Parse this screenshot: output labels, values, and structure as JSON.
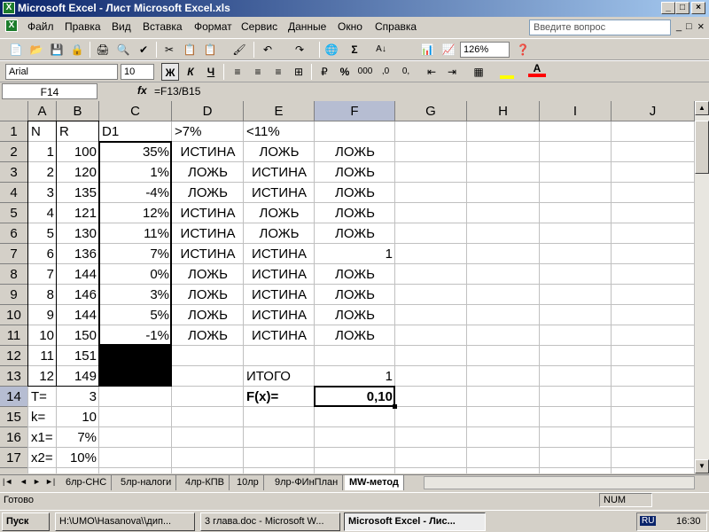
{
  "window": {
    "title": "Microsoft Excel - Лист Microsoft Excel.xls",
    "min": "_",
    "max": "□",
    "close": "×"
  },
  "menu": {
    "items": [
      "Файл",
      "Правка",
      "Вид",
      "Вставка",
      "Формат",
      "Сервис",
      "Данные",
      "Окно",
      "Справка"
    ],
    "help_placeholder": "Введите вопрос",
    "doc_min": "_",
    "doc_max": "□",
    "doc_close": "×"
  },
  "toolbar": {
    "zoom": "126%",
    "buttons": [
      "📄",
      "📂",
      "💾",
      "🔒",
      "🖨",
      "🔍",
      "✔",
      "✂",
      "📋",
      "📋",
      "🖌",
      "↶",
      "↷",
      "🌐",
      "Σ",
      "А↓",
      "📊",
      "📈",
      "❓"
    ]
  },
  "format_bar": {
    "font": "Arial",
    "size": "10",
    "bold": "Ж",
    "italic": "К",
    "underline": "Ч",
    "percent": "%",
    "thousands": "000",
    "other_buttons": [
      "≡",
      "≡",
      "≡",
      "⊞",
      "₽",
      ",0",
      "0,",
      "⇤",
      "⇥",
      "▦",
      "A"
    ]
  },
  "formula_bar": {
    "name_box": "F14",
    "fx": "fx",
    "formula": "=F13/B15"
  },
  "columns": [
    "A",
    "B",
    "C",
    "D",
    "E",
    "F",
    "G",
    "H",
    "I",
    "J"
  ],
  "rows": [
    "1",
    "2",
    "3",
    "4",
    "5",
    "6",
    "7",
    "8",
    "9",
    "10",
    "11",
    "12",
    "13",
    "14",
    "15",
    "16",
    "17",
    "18"
  ],
  "cells": {
    "r1": [
      "N",
      "R",
      "D1",
      ">7%",
      "<11%",
      ""
    ],
    "data": [
      [
        "1",
        "100",
        "35%",
        "ИСТИНА",
        "ЛОЖЬ",
        "ЛОЖЬ"
      ],
      [
        "2",
        "120",
        "1%",
        "ЛОЖЬ",
        "ИСТИНА",
        "ЛОЖЬ"
      ],
      [
        "3",
        "135",
        "-4%",
        "ЛОЖЬ",
        "ИСТИНА",
        "ЛОЖЬ"
      ],
      [
        "4",
        "121",
        "12%",
        "ИСТИНА",
        "ЛОЖЬ",
        "ЛОЖЬ"
      ],
      [
        "5",
        "130",
        "11%",
        "ИСТИНА",
        "ЛОЖЬ",
        "ЛОЖЬ"
      ],
      [
        "6",
        "136",
        "7%",
        "ИСТИНА",
        "ИСТИНА",
        "1"
      ],
      [
        "7",
        "144",
        "0%",
        "ЛОЖЬ",
        "ИСТИНА",
        "ЛОЖЬ"
      ],
      [
        "8",
        "146",
        "3%",
        "ЛОЖЬ",
        "ИСТИНА",
        "ЛОЖЬ"
      ],
      [
        "9",
        "144",
        "5%",
        "ЛОЖЬ",
        "ИСТИНА",
        "ЛОЖЬ"
      ],
      [
        "10",
        "150",
        "-1%",
        "ЛОЖЬ",
        "ИСТИНА",
        "ЛОЖЬ"
      ]
    ],
    "r12": [
      "11",
      "151"
    ],
    "r13": [
      "12",
      "149",
      "ИТОГО",
      "1"
    ],
    "r14": [
      "T=",
      "3",
      "F(x)=",
      "0,10"
    ],
    "r15": [
      "k=",
      "10"
    ],
    "r16": [
      "x1=",
      "7%"
    ],
    "r17": [
      "x2=",
      "10%"
    ]
  },
  "sheet_tabs": [
    "6лр-СНС",
    "5лр-налоги",
    "4лр-КПВ",
    "10лр",
    "9лр-ФИнПлан",
    "MW-метод"
  ],
  "tab_nav": [
    "|◄",
    "◄",
    "►",
    "►|"
  ],
  "status": {
    "ready": "Готово",
    "num": "NUM"
  },
  "taskbar": {
    "start": "Пуск",
    "items": [
      "H:\\UMO\\Hasanova\\\\дип...",
      "3 глава.doc - Microsoft W...",
      "Microsoft Excel - Лис..."
    ],
    "lang": "RU",
    "time": "16:30"
  }
}
